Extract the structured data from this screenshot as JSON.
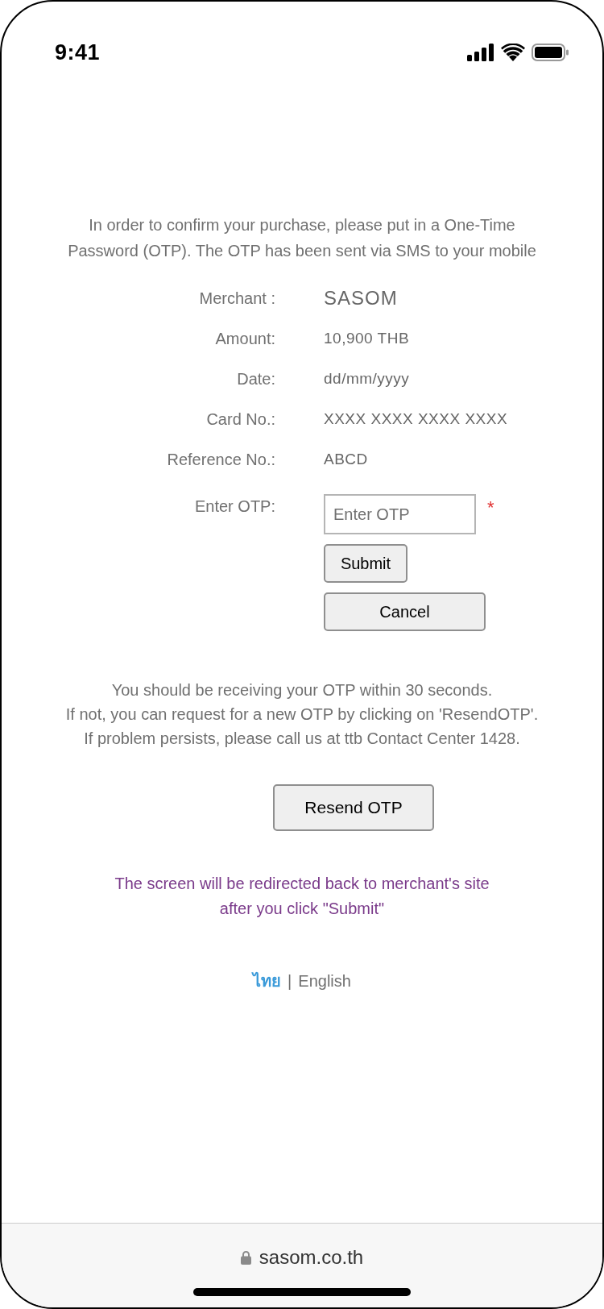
{
  "status_bar": {
    "time": "9:41"
  },
  "intro": {
    "lines": [
      "In order to confirm your purchase, please put in a One-Time",
      "Password (OTP). The OTP has been sent via SMS to your mobile"
    ]
  },
  "details": [
    {
      "label": "Merchant :",
      "value": "SASOM",
      "kind": "emphasis"
    },
    {
      "label": "Amount:",
      "value": "10,900 THB",
      "kind": "plain"
    },
    {
      "label": "Date:",
      "value": "dd/mm/yyyy",
      "kind": "plain"
    },
    {
      "label": "Card No.:",
      "value": "XXXX XXXX XXXX XXXX",
      "kind": "plain"
    },
    {
      "label": "Reference No.:",
      "value": "ABCD",
      "kind": "plain"
    }
  ],
  "otp": {
    "label": "Enter OTP:",
    "placeholder": "Enter OTP",
    "required_mark": "*"
  },
  "buttons": {
    "submit": "Submit",
    "cancel": "Cancel",
    "resend": "Resend OTP"
  },
  "help": {
    "lines": [
      "You should be receiving your OTP within 30 seconds.",
      "If not, you can request for a new OTP by clicking on 'ResendOTP'.",
      "If problem persists, please call us at ttb Contact Center 1428."
    ]
  },
  "redirect_note": {
    "lines": [
      "The screen will be redirected back to merchant's site",
      "after you click \"Submit\""
    ]
  },
  "languages": {
    "separator": "|",
    "items": [
      {
        "label": "ไทย",
        "selected": false
      },
      {
        "label": "English",
        "selected": true
      }
    ]
  },
  "browser_bar": {
    "domain": "sasom.co.th",
    "secure": true
  }
}
